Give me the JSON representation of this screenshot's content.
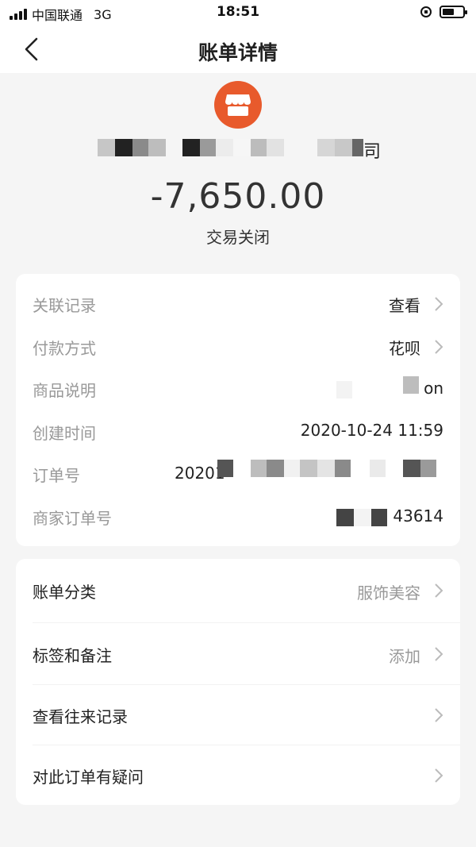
{
  "status_bar": {
    "carrier": "中国联通",
    "network": "3G",
    "time": "18:51"
  },
  "nav": {
    "title": "账单详情"
  },
  "merchant": {
    "icon": "store-icon",
    "name_suffix": "司",
    "logo_color": "#e85a2c"
  },
  "amount": "-7,650.00",
  "status": "交易关闭",
  "details": [
    {
      "label": "关联记录",
      "value": "查看",
      "chevron": true
    },
    {
      "label": "付款方式",
      "value": "花呗",
      "chevron": true
    },
    {
      "label": "商品说明",
      "value": "on",
      "chevron": false
    },
    {
      "label": "创建时间",
      "value": "2020-10-24 11:59",
      "chevron": false
    },
    {
      "label": "订单号",
      "value": "20201",
      "chevron": false
    },
    {
      "label": "商家订单号",
      "value": "43614",
      "chevron": false
    }
  ],
  "actions": [
    {
      "label": "账单分类",
      "value": "服饰美容",
      "chevron": true
    },
    {
      "label": "标签和备注",
      "value": "添加",
      "chevron": true
    },
    {
      "label": "查看往来记录",
      "value": "",
      "chevron": true
    },
    {
      "label": "对此订单有疑问",
      "value": "",
      "chevron": true
    }
  ]
}
